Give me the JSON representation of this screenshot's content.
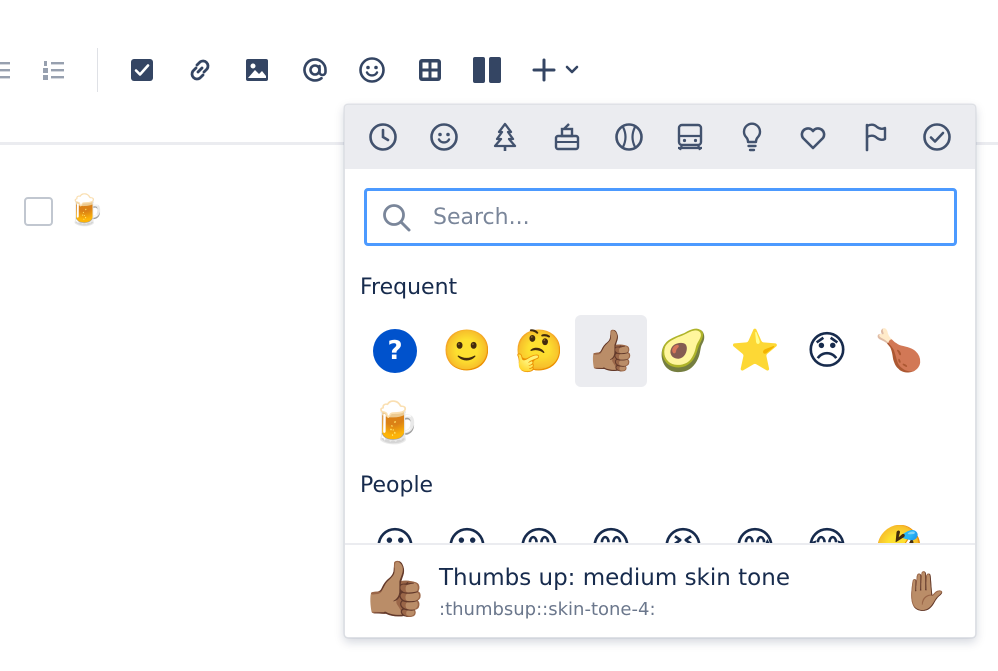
{
  "toolbar": {
    "icons": [
      "bullet-list-icon",
      "numbered-list-icon",
      "action-item-icon",
      "link-icon",
      "image-icon",
      "mention-icon",
      "emoji-icon",
      "table-icon",
      "layouts-icon",
      "insert-plus-icon",
      "chevron-down-icon"
    ]
  },
  "editor": {
    "emoji": "🍺"
  },
  "picker": {
    "categories": [
      "frequent-clock-icon",
      "people-smiley-icon",
      "nature-tree-icon",
      "food-icon",
      "activity-ball-icon",
      "travel-train-icon",
      "objects-bulb-icon",
      "symbols-heart-icon",
      "flags-icon",
      "productivity-check-icon"
    ],
    "search": {
      "placeholder": "Search...",
      "value": ""
    },
    "frequent": {
      "title": "Frequent",
      "emojis": [
        "?",
        "🙂",
        "🤔",
        "👍🏽",
        "🥑",
        "⭐",
        "😞",
        "🍗",
        "🍺"
      ]
    },
    "people": {
      "title": "People",
      "emojis": [
        "😀",
        "😃",
        "😄",
        "😁",
        "😆",
        "😅",
        "😂",
        "🤣"
      ]
    },
    "preview": {
      "emoji": "👍🏽",
      "name": "Thumbs up: medium skin tone",
      "shortcode": ":thumbsup::skin-tone-4:",
      "tone_emoji": "✋🏽"
    }
  },
  "colors": {
    "accent": "#4c9aff",
    "icon": "#344563",
    "question_bg": "#0052cc"
  }
}
